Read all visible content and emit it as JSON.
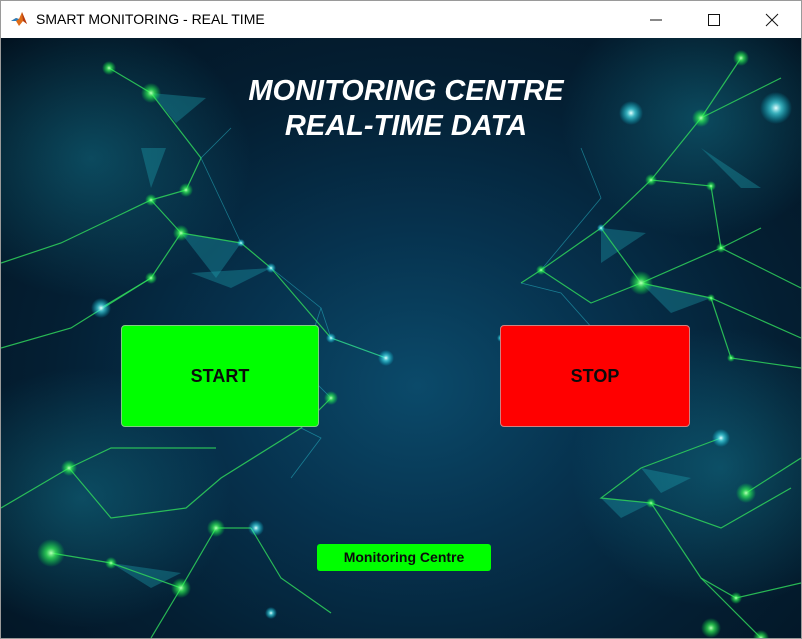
{
  "window": {
    "title": "SMART MONITORING - REAL TIME",
    "icon": "matlab-app-icon",
    "controls": [
      "minimize-icon",
      "maximize-icon",
      "close-icon"
    ]
  },
  "main": {
    "heading_line1": "MONITORING CENTRE",
    "heading_line2": "REAL-TIME DATA",
    "start_label": "START",
    "stop_label": "STOP",
    "status_label": "Monitoring Centre"
  },
  "colors": {
    "start": "#00ff00",
    "stop": "#ff0000",
    "status": "#00ff00",
    "background": "#06324e",
    "network_lines": "#2fd35a",
    "network_glow": "#38d8e8"
  }
}
